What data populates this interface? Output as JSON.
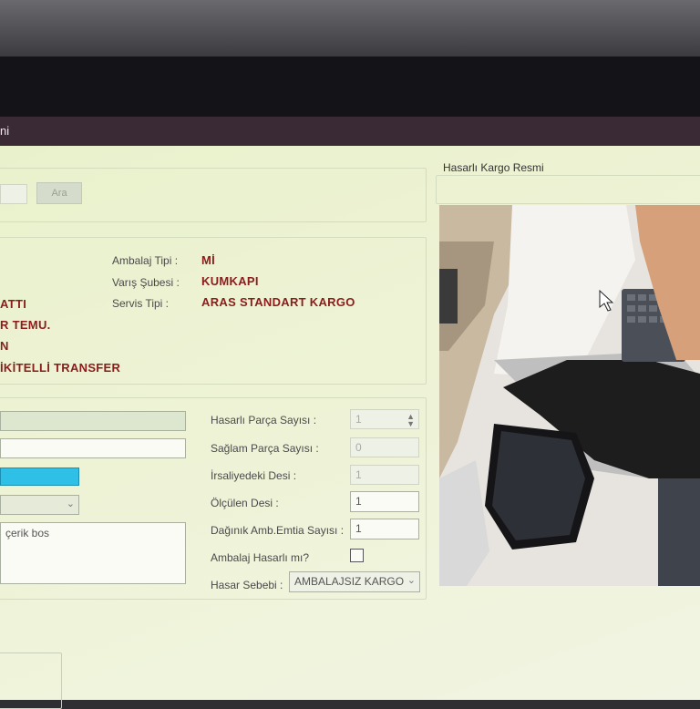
{
  "window": {
    "title": "ni"
  },
  "search": {
    "button_label": "Ara"
  },
  "info": {
    "left_fragments": [
      "ATTI",
      "R TEMU.",
      "N",
      "İKİTELLİ TRANSFER"
    ],
    "ambalaj_tipi": {
      "label": "Ambalaj Tipi :",
      "value": "Mİ"
    },
    "varis_subesi": {
      "label": "Varış Şubesi :",
      "value": "KUMKAPI"
    },
    "servis_tipi": {
      "label": "Servis Tipi :",
      "value": "ARAS STANDART KARGO"
    }
  },
  "form": {
    "note_text": "çerik bos",
    "hasarli_parca": {
      "label": "Hasarlı Parça Sayısı :",
      "value": "1"
    },
    "saglam_parca": {
      "label": "Sağlam Parça Sayısı :",
      "value": "0"
    },
    "irsaliye_desi": {
      "label": "İrsaliyedeki Desi :",
      "value": "1"
    },
    "olculen_desi": {
      "label": "Ölçülen Desi :",
      "value": "1"
    },
    "daginik": {
      "label": "Dağınık Amb.Emtia Sayısı :",
      "value": "1"
    },
    "ambalaj_hasarli": {
      "label": "Ambalaj Hasarlı mı?",
      "checked": false
    },
    "hasar_sebebi": {
      "label": "Hasar Sebebi :",
      "value": "AMBALAJSIZ KARGO"
    }
  },
  "image_panel": {
    "title": "Hasarlı Kargo Resmi"
  },
  "colors": {
    "accent_field": "#2ec0e6",
    "value_text": "#8b1c1c",
    "background": "#eef3d6"
  },
  "icons": [
    "chevron-down-icon",
    "spin-arrows-icon",
    "mouse-cursor-icon"
  ]
}
